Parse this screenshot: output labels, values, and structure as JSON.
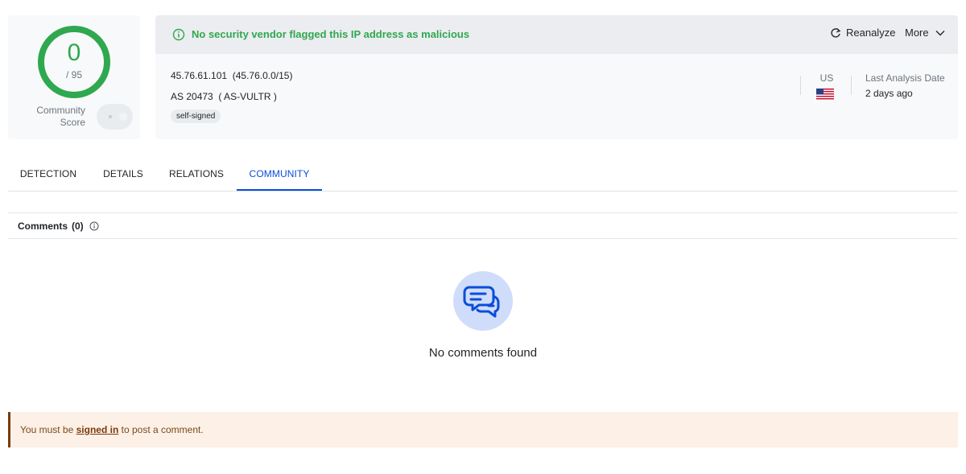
{
  "score": {
    "value": "0",
    "total": "/ 95",
    "community_label_line1": "Community",
    "community_label_line2": "Score",
    "ring_color": "#2fa84f"
  },
  "banner": {
    "message": "No security vendor flagged this IP address as malicious",
    "icon": "info-circle-icon",
    "color": "#2fa84f"
  },
  "actions": {
    "reanalyze_label": "Reanalyze",
    "more_label": "More"
  },
  "ip": {
    "address": "45.76.61.101",
    "network": "(45.76.0.0/15)",
    "as_number": "AS 20473",
    "as_name": "( AS-VULTR )",
    "tag": "self-signed"
  },
  "meta": {
    "country": "US",
    "flag_icon": "us-flag-icon",
    "last_analysis_label": "Last Analysis Date",
    "last_analysis_value": "2 days ago"
  },
  "tabs": [
    {
      "label": "DETECTION",
      "active": false
    },
    {
      "label": "DETAILS",
      "active": false
    },
    {
      "label": "RELATIONS",
      "active": false
    },
    {
      "label": "COMMUNITY",
      "active": true
    }
  ],
  "comments": {
    "title": "Comments",
    "count": "(0)",
    "empty_text": "No comments found",
    "empty_icon": "chat-bubbles-icon"
  },
  "signin": {
    "prefix": "You must be",
    "link": "signed in",
    "suffix": "to post a comment."
  },
  "colors": {
    "accent": "#0b4dda",
    "success": "#2fa84f",
    "warning_bg": "#fdf0e6",
    "warning_border": "#7a3b0b"
  }
}
